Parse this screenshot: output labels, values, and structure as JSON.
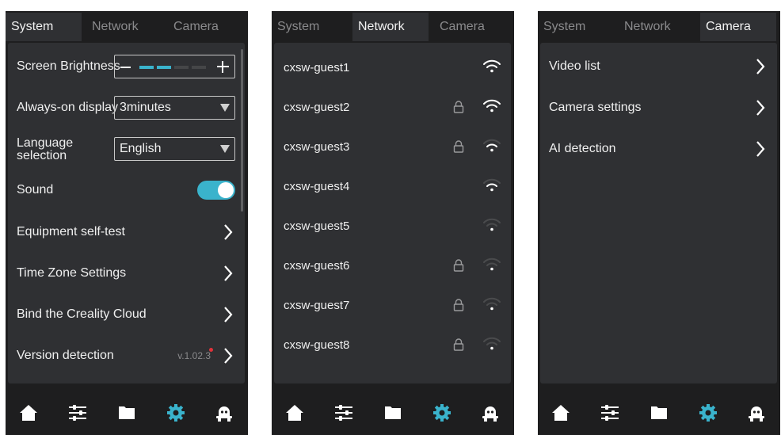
{
  "colors": {
    "accent": "#3ab3cc",
    "background": "#1e1e1f",
    "panel": "#2f3033",
    "notification_dot": "#e0323a"
  },
  "screens": {
    "system": {
      "tabs": [
        "System",
        "Network",
        "Camera"
      ],
      "active_tab": "System",
      "rows": {
        "screen_brightness": {
          "label": "Screen Brightness",
          "level_segments_on": 2,
          "segments_total": 5
        },
        "always_on_display": {
          "label": "Always-on display",
          "value": "3minutes"
        },
        "language_selection": {
          "label_line1": "Language",
          "label_line2": "selection",
          "value": "English"
        },
        "sound": {
          "label": "Sound",
          "enabled": true
        },
        "equipment_self_test": {
          "label": "Equipment self-test"
        },
        "time_zone_settings": {
          "label": "Time Zone Settings"
        },
        "bind_creality_cloud": {
          "label": "Bind the Creality Cloud"
        },
        "version_detection": {
          "label": "Version detection",
          "version": "v.1.02.3",
          "update_available": true
        }
      }
    },
    "network": {
      "tabs": [
        "System",
        "Network",
        "Camera"
      ],
      "active_tab": "Network",
      "networks": [
        {
          "name": "cxsw-guest1",
          "locked": false,
          "signal_bars": 3
        },
        {
          "name": "cxsw-guest2",
          "locked": true,
          "signal_bars": 3
        },
        {
          "name": "cxsw-guest3",
          "locked": true,
          "signal_bars": 2
        },
        {
          "name": "cxsw-guest4",
          "locked": false,
          "signal_bars": 2
        },
        {
          "name": "cxsw-guest5",
          "locked": false,
          "signal_bars": 1
        },
        {
          "name": "cxsw-guest6",
          "locked": true,
          "signal_bars": 1
        },
        {
          "name": "cxsw-guest7",
          "locked": true,
          "signal_bars": 1
        },
        {
          "name": "cxsw-guest8",
          "locked": true,
          "signal_bars": 1
        }
      ]
    },
    "camera": {
      "tabs": [
        "System",
        "Network",
        "Camera"
      ],
      "active_tab": "Camera",
      "items": [
        "Video list",
        "Camera settings",
        "AI detection"
      ]
    }
  },
  "navbar": {
    "icons": [
      "home-icon",
      "sliders-icon",
      "folder-icon",
      "gear-icon",
      "robot-icon"
    ],
    "active": "gear-icon"
  }
}
